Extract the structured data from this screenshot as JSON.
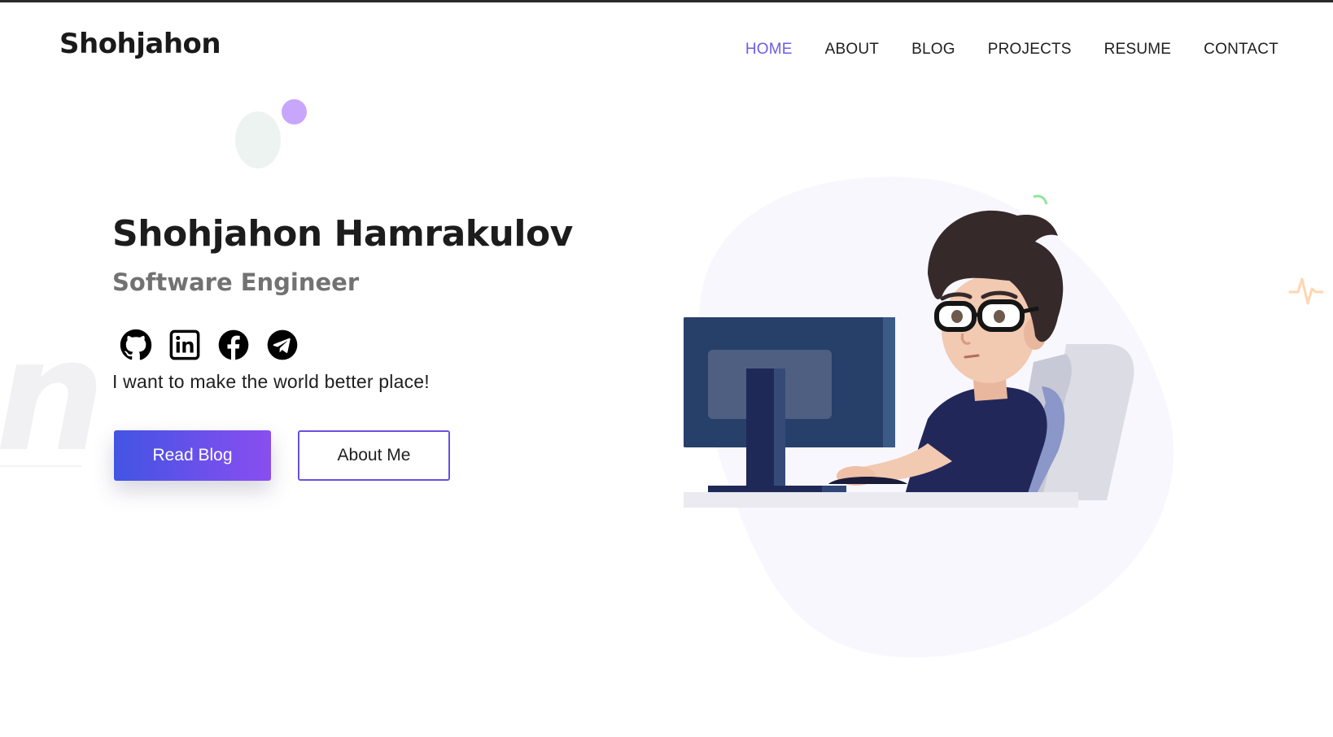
{
  "header": {
    "logo": "Shohjahon",
    "nav": [
      {
        "label": "HOME",
        "active": true
      },
      {
        "label": "ABOUT",
        "active": false
      },
      {
        "label": "BLOG",
        "active": false
      },
      {
        "label": "PROJECTS",
        "active": false
      },
      {
        "label": "RESUME",
        "active": false
      },
      {
        "label": "CONTACT",
        "active": false
      }
    ]
  },
  "hero": {
    "name": "Shohjahon Hamrakulov",
    "role": "Software Engineer",
    "tagline": "I want to make the world better place!",
    "primary_button": "Read Blog",
    "secondary_button": "About Me",
    "socials": [
      "github-icon",
      "linkedin-icon",
      "facebook-icon",
      "telegram-icon"
    ]
  },
  "colors": {
    "accent": "#6c5ce7",
    "gradient_start": "#4254e3",
    "gradient_end": "#8a4ef0",
    "dot": "#c7a6fb",
    "role_text": "#727272"
  }
}
